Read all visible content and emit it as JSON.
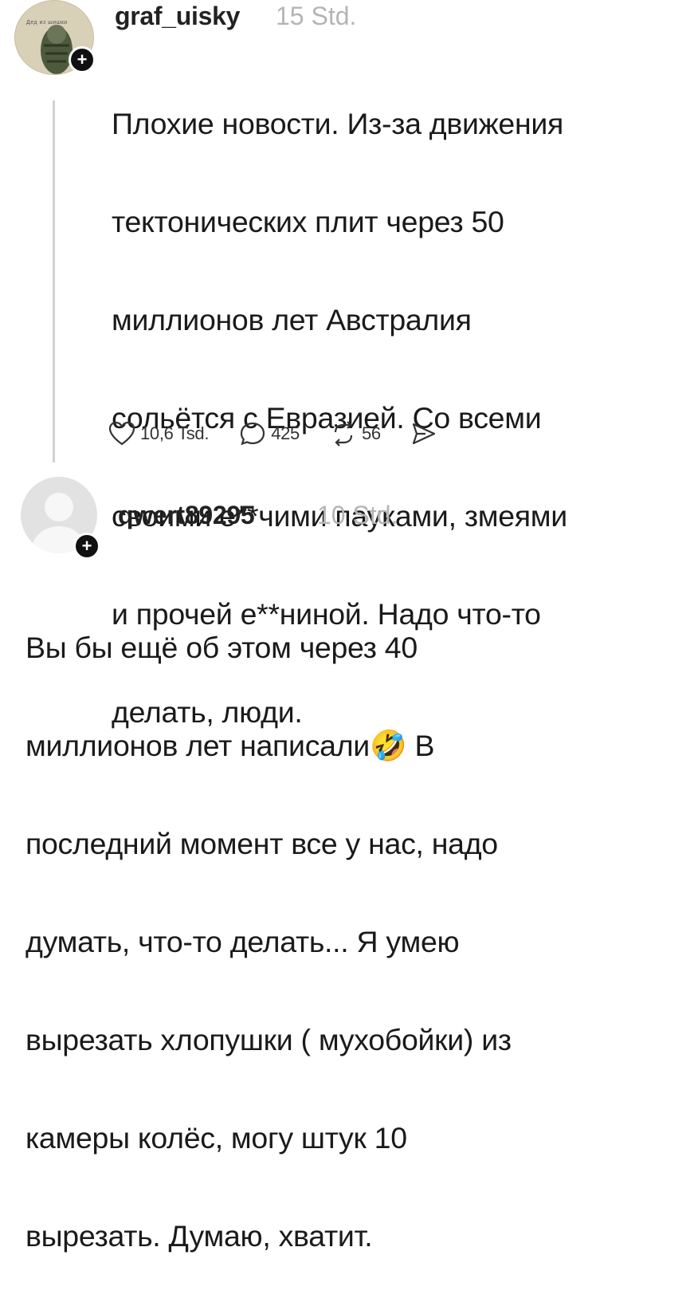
{
  "post1": {
    "avatar_caption": "Дед из шишки",
    "username": "graf_uisky",
    "time": "15 Std.",
    "text_lines": [
      "Плохие новости. Из-за движения",
      "тектонических плит через 50",
      "миллионов лет Австралия",
      "сольётся с Евразией. Со всеми",
      "своими е**чими пауками, змеями",
      "и прочей е**ниной. Надо что-то",
      "делать, люди."
    ],
    "likes": "10,6 Tsd.",
    "comments": "425",
    "reposts": "56"
  },
  "post2": {
    "username": "qwert89295",
    "time": "10 Std.",
    "text_lines": [
      "Вы бы ещё об этом через 40",
      "миллионов лет написали🤣 В",
      "последний момент все у нас, надо",
      "думать, что-то делать... Я умею",
      "вырезать хлопушки ( мухобойки) из",
      "камеры колёс, могу штук 10",
      "вырезать. Думаю, хватит."
    ]
  },
  "icons": {
    "like": "heart-icon",
    "comment": "speech-bubble-icon",
    "repost": "repost-icon",
    "share": "send-icon",
    "follow": "plus-icon"
  }
}
